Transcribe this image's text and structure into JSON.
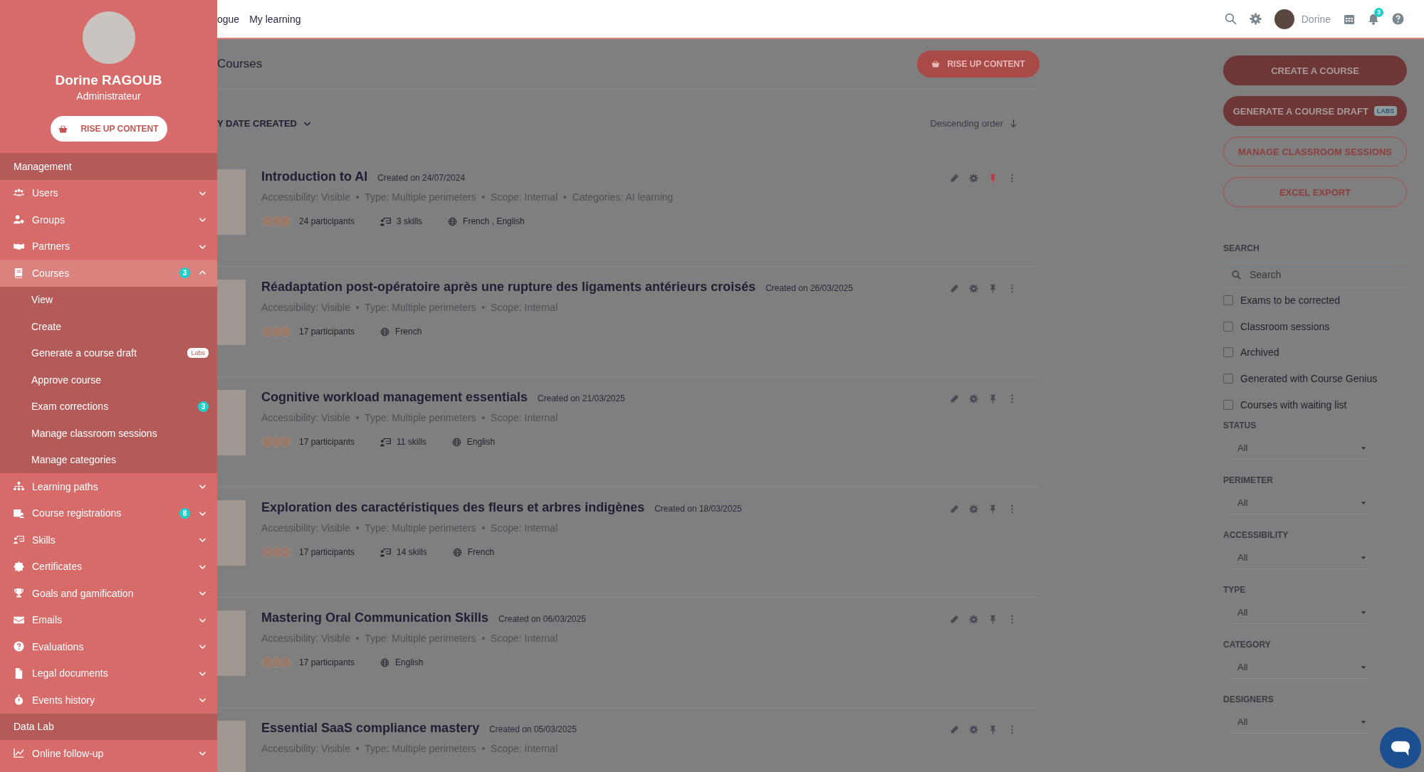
{
  "sidebar": {
    "profile": {
      "name": "Dorine RAGOUB",
      "role": "Administrateur"
    },
    "content_button": "RISE UP CONTENT",
    "sections": [
      {
        "title": "Management",
        "items": [
          {
            "label": "Users",
            "selected": false,
            "expanded": false
          },
          {
            "label": "Groups",
            "selected": false,
            "expanded": false
          },
          {
            "label": "Partners",
            "selected": false,
            "expanded": false
          },
          {
            "label": "Courses",
            "selected": true,
            "expanded": true,
            "badge": "3",
            "children": [
              {
                "label": "View"
              },
              {
                "label": "Create"
              },
              {
                "label": "Generate a course draft",
                "tag": "Labs"
              },
              {
                "label": "Approve course"
              },
              {
                "label": "Exam corrections",
                "badge": "3"
              },
              {
                "label": "Manage classroom sessions"
              },
              {
                "label": "Manage categories"
              }
            ]
          },
          {
            "label": "Learning paths",
            "selected": false,
            "expanded": false
          },
          {
            "label": "Course registrations",
            "selected": false,
            "expanded": false,
            "badge": "8"
          },
          {
            "label": "Skills",
            "selected": false,
            "expanded": false
          },
          {
            "label": "Certificates",
            "selected": false,
            "expanded": false
          },
          {
            "label": "Goals and gamification",
            "selected": false,
            "expanded": false
          },
          {
            "label": "Emails",
            "selected": false,
            "expanded": false
          },
          {
            "label": "Evaluations",
            "selected": false,
            "expanded": false
          },
          {
            "label": "Legal documents",
            "selected": false,
            "expanded": false
          },
          {
            "label": "Events history",
            "selected": false,
            "expanded": false
          }
        ]
      },
      {
        "title": "Data Lab",
        "items": [
          {
            "label": "Online follow-up",
            "selected": false,
            "expanded": false
          }
        ]
      }
    ]
  },
  "header": {
    "nav": [
      "ogue",
      "My learning"
    ],
    "user": "Dorine",
    "notification_count": "3"
  },
  "main": {
    "title": "Courses",
    "content_button": "RISE UP CONTENT",
    "sort": "Y DATE CREATED",
    "order": "Descending order",
    "courses": [
      {
        "title": "Introduction to AI",
        "created": "Created on 24/07/2024",
        "meta": "Accessibility: Visible  •  Type: Multiple perimeters  •  Scope: Internal  •  Categories: AI learning",
        "participants": "24 participants",
        "skills": "3 skills",
        "languages": "French , English",
        "pinned": true
      },
      {
        "title": "Réadaptation post-opératoire après une rupture des ligaments antérieurs croisés",
        "created": "Created on 26/03/2025",
        "meta": "Accessibility: Visible  •  Type: Multiple perimeters  •  Scope: Internal",
        "participants": "17 participants",
        "languages": "French",
        "pinned": false
      },
      {
        "title": "Cognitive workload management essentials",
        "created": "Created on 21/03/2025",
        "meta": "Accessibility: Visible  •  Type: Multiple perimeters  •  Scope: Internal",
        "participants": "17 participants",
        "skills": "11 skills",
        "languages": "English",
        "pinned": false
      },
      {
        "title": "Exploration des caractéristiques des fleurs et arbres indigènes",
        "created": "Created on 18/03/2025",
        "meta": "Accessibility: Visible  •  Type: Multiple perimeters  •  Scope: Internal",
        "participants": "17 participants",
        "skills": "14 skills",
        "languages": "French",
        "pinned": false
      },
      {
        "title": "Mastering Oral Communication Skills",
        "created": "Created on 06/03/2025",
        "meta": "Accessibility: Visible  •  Type: Multiple perimeters  •  Scope: Internal",
        "participants": "17 participants",
        "languages": "English",
        "pinned": false
      },
      {
        "title": "Essential SaaS compliance mastery",
        "created": "Created on 05/03/2025",
        "meta": "Accessibility: Visible  •  Type: Multiple perimeters  •  Scope: Internal",
        "pinned": false
      }
    ]
  },
  "panel": {
    "buttons": [
      {
        "label": "CREATE A COURSE",
        "kind": "filled"
      },
      {
        "label": "GENERATE A COURSE DRAFT",
        "kind": "filled",
        "tag": "LABS"
      },
      {
        "label": "MANAGE CLASSROOM SESSIONS",
        "kind": "outline"
      },
      {
        "label": "EXCEL EXPORT",
        "kind": "outline"
      }
    ],
    "search_label": "SEARCH",
    "search": {
      "placeholder": "Search"
    },
    "checkboxes": [
      {
        "label": "Exams to be corrected",
        "checked": false
      },
      {
        "label": "Classroom sessions",
        "checked": false
      },
      {
        "label": "Archived",
        "checked": false
      },
      {
        "label": "Generated with Course Genius",
        "checked": false
      },
      {
        "label": "Courses with waiting list",
        "checked": false
      }
    ],
    "filters": [
      {
        "label": "STATUS",
        "value": "All"
      },
      {
        "label": "PERIMETER",
        "value": "All"
      },
      {
        "label": "ACCESSIBILITY",
        "value": "All"
      },
      {
        "label": "TYPE",
        "value": "All"
      },
      {
        "label": "CATEGORY",
        "value": "All"
      },
      {
        "label": "DESIGNERS",
        "value": "All"
      }
    ]
  }
}
